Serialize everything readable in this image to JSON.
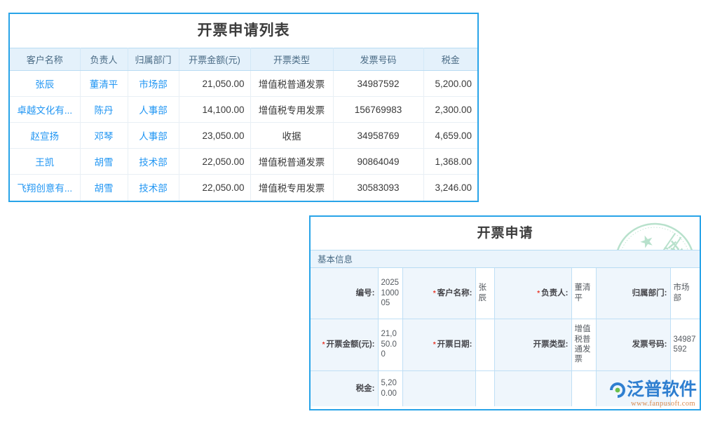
{
  "list_panel": {
    "title": "开票申请列表",
    "columns": [
      "客户名称",
      "负责人",
      "归属部门",
      "开票金额(元)",
      "开票类型",
      "发票号码",
      "税金"
    ],
    "rows": [
      {
        "customer": "张辰",
        "owner": "董清平",
        "dept": "市场部",
        "amount": "21,050.00",
        "invoice_type": "增值税普通发票",
        "invoice_no": "34987592",
        "tax": "5,200.00"
      },
      {
        "customer": "卓越文化有...",
        "owner": "陈丹",
        "dept": "人事部",
        "amount": "14,100.00",
        "invoice_type": "增值税专用发票",
        "invoice_no": "156769983",
        "tax": "2,300.00"
      },
      {
        "customer": "赵宣扬",
        "owner": "邓琴",
        "dept": "人事部",
        "amount": "23,050.00",
        "invoice_type": "收据",
        "invoice_no": "34958769",
        "tax": "4,659.00"
      },
      {
        "customer": "王凯",
        "owner": "胡雪",
        "dept": "技术部",
        "amount": "22,050.00",
        "invoice_type": "增值税普通发票",
        "invoice_no": "90864049",
        "tax": "1,368.00"
      },
      {
        "customer": "飞翔创意有...",
        "owner": "胡雪",
        "dept": "技术部",
        "amount": "22,050.00",
        "invoice_type": "增值税专用发票",
        "invoice_no": "30583093",
        "tax": "3,246.00"
      }
    ]
  },
  "form_panel": {
    "title": "开票申请",
    "section": "基本信息",
    "fields": {
      "code_label": "编号:",
      "code_value": "2025100005",
      "customer_label": "客户名称:",
      "customer_value": "张辰",
      "owner_label": "负责人:",
      "owner_value": "董清平",
      "dept_label": "归属部门:",
      "dept_value": "市场部",
      "amount_label": "开票金额(元):",
      "amount_value": "21,050.00",
      "date_label": "开票日期:",
      "date_value": "",
      "type_label": "开票类型:",
      "type_value": "增值税普通发票",
      "invoice_no_label": "发票号码:",
      "invoice_no_value": "34987592",
      "tax_label": "税金:",
      "tax_value": "5,200.00"
    },
    "required_marker": "*"
  },
  "stamp": {
    "text": "审核通过",
    "color": "#7fc9a4"
  },
  "logo": {
    "text": "泛普软件",
    "url": "www.fanpusoft.com",
    "color": "#2f7fd0"
  },
  "theme": {
    "panel_border": "#29a4e8",
    "header_bg": "#e4f1fb",
    "link_color": "#2196f3",
    "required_color": "#e8392b"
  }
}
